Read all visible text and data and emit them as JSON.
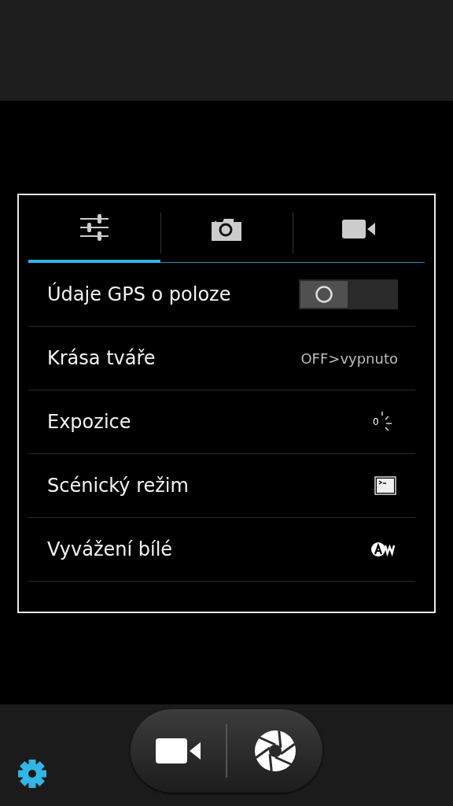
{
  "tabs": [
    {
      "kind": "general",
      "selected": true
    },
    {
      "kind": "photo",
      "selected": false
    },
    {
      "kind": "video",
      "selected": false
    }
  ],
  "settings": [
    {
      "kind": "switch",
      "label": "Údaje GPS o poloze",
      "on": false
    },
    {
      "kind": "text",
      "label": "Krása tváře",
      "value": "OFF>vypnuto"
    },
    {
      "kind": "exposure",
      "label": "Expozice",
      "value": "0"
    },
    {
      "kind": "scene",
      "label": "Scénický režim"
    },
    {
      "kind": "white_balance",
      "label": "Vyvážení bílé"
    }
  ]
}
